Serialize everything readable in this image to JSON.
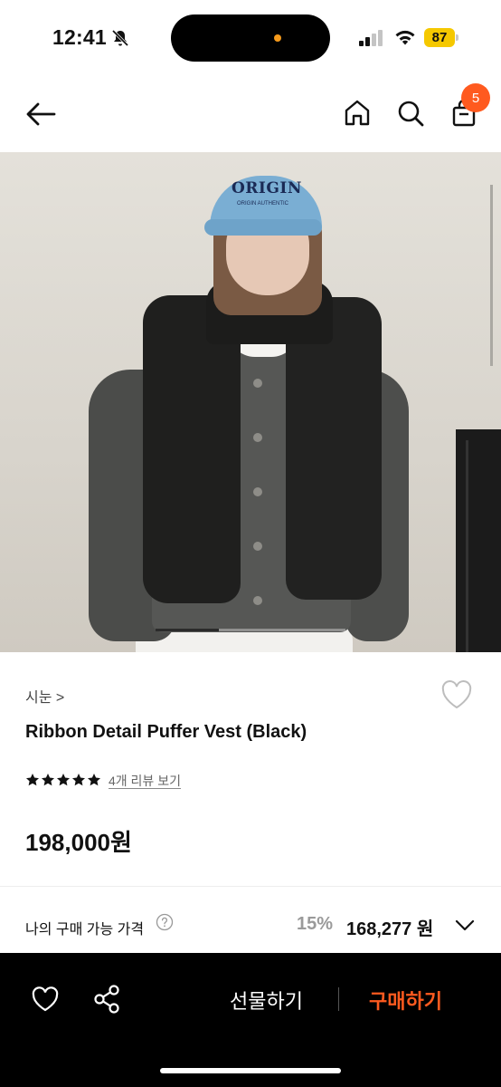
{
  "status_bar": {
    "time": "12:41",
    "battery": "87",
    "icons": [
      "bell-off-icon",
      "signal-icon",
      "wifi-icon",
      "battery-icon"
    ],
    "battery_color": "#f5c800"
  },
  "nav": {
    "icons": [
      "back-arrow-icon",
      "home-icon",
      "search-icon",
      "shopping-bag-icon"
    ],
    "cart_count": "5",
    "badge_color": "#ff5a1f"
  },
  "product": {
    "brand": "시눈 >",
    "name": "Ribbon Detail Puffer Vest (Black)",
    "rating_stars": 5,
    "review_link": "4개 리뷰 보기",
    "price": "198,000원",
    "image_text": "ORIGIN",
    "image_subtext": "ORIGIN AUTHENTIC"
  },
  "my_price": {
    "label": "나의 구매 가능 가격",
    "discount": "15%",
    "price": "168,277 원"
  },
  "bottom_bar": {
    "gift_label": "선물하기",
    "buy_label": "구매하기",
    "accent_color": "#ff5a1f"
  }
}
